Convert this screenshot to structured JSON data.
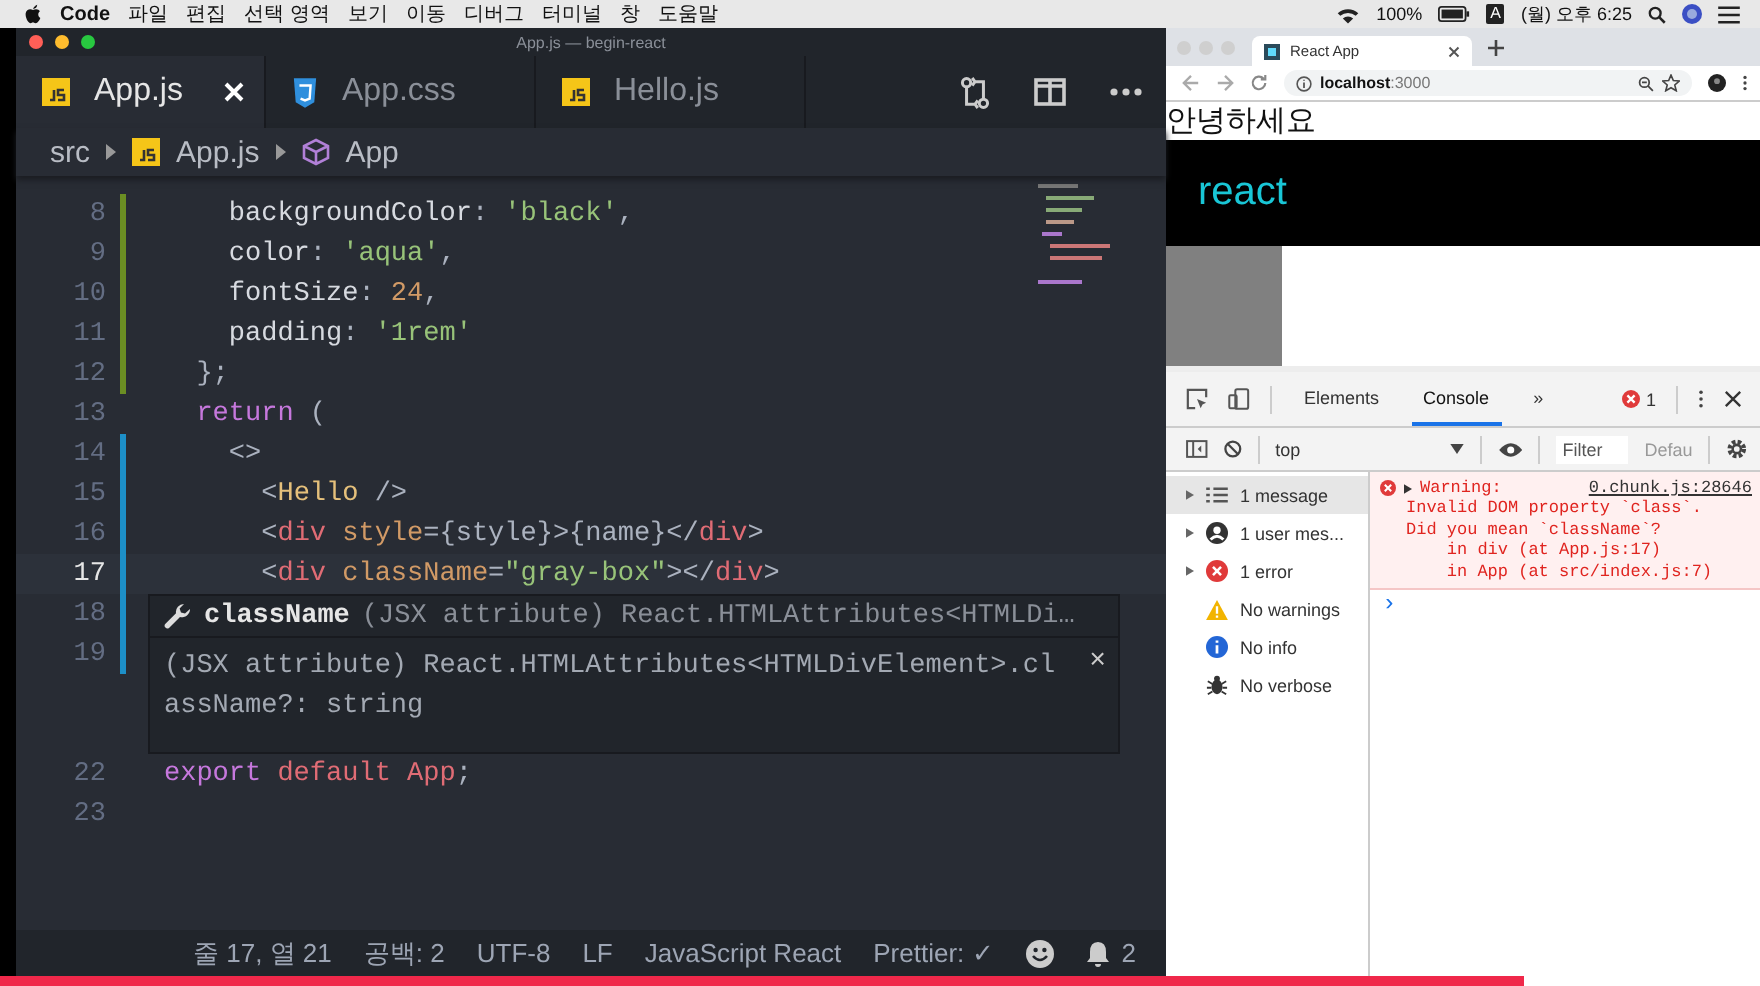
{
  "menubar": {
    "app": "Code",
    "menus": [
      "파일",
      "편집",
      "선택 영역",
      "보기",
      "이동",
      "디버그",
      "터미널",
      "창",
      "도움말"
    ],
    "battery": "100%",
    "input_source": "A",
    "clock": "(월) 오후 6:25"
  },
  "editor": {
    "window_title": "App.js — begin-react",
    "tabs": [
      {
        "label": "App.js",
        "kind": "js",
        "selected": true
      },
      {
        "label": "App.css",
        "kind": "css",
        "selected": false
      },
      {
        "label": "Hello.js",
        "kind": "js",
        "selected": false
      }
    ],
    "breadcrumb": [
      {
        "label": "src",
        "kind": "folder"
      },
      {
        "label": "App.js",
        "kind": "js"
      },
      {
        "label": "App",
        "kind": "symbol"
      }
    ],
    "lines": [
      {
        "number": "8",
        "color": "#6b8e23",
        "current": false,
        "tokens": [
          {
            "text": "    backgroundColor",
            "kind": "prop"
          },
          {
            "text": ": ",
            "kind": "punct"
          },
          {
            "text": "'black'",
            "kind": "string"
          },
          {
            "text": ",",
            "kind": "punct"
          }
        ]
      },
      {
        "number": "9",
        "color": "#6b8e23",
        "current": false,
        "tokens": [
          {
            "text": "    color",
            "kind": "prop"
          },
          {
            "text": ": ",
            "kind": "punct"
          },
          {
            "text": "'aqua'",
            "kind": "string"
          },
          {
            "text": ",",
            "kind": "punct"
          }
        ]
      },
      {
        "number": "10",
        "color": "#6b8e23",
        "current": false,
        "tokens": [
          {
            "text": "    fontSize",
            "kind": "prop"
          },
          {
            "text": ": ",
            "kind": "punct"
          },
          {
            "text": "24",
            "kind": "number"
          },
          {
            "text": ",",
            "kind": "punct"
          }
        ]
      },
      {
        "number": "11",
        "color": "#6b8e23",
        "current": false,
        "tokens": [
          {
            "text": "    padding",
            "kind": "prop"
          },
          {
            "text": ": ",
            "kind": "punct"
          },
          {
            "text": "'1rem'",
            "kind": "string"
          }
        ]
      },
      {
        "number": "12",
        "color": "#6b8e23",
        "current": false,
        "tokens": [
          {
            "text": "  };",
            "kind": "punct"
          }
        ]
      },
      {
        "number": "13",
        "current": false,
        "tokens": [
          {
            "text": "  return",
            "kind": "keyword"
          },
          {
            "text": " (",
            "kind": "punct"
          }
        ]
      },
      {
        "number": "14",
        "color": "#1d8fc7",
        "current": false,
        "tokens": [
          {
            "text": "    <>",
            "kind": "punct"
          }
        ]
      },
      {
        "number": "15",
        "color": "#1d8fc7",
        "current": false,
        "tokens": [
          {
            "text": "      <",
            "kind": "punct"
          },
          {
            "text": "Hello",
            "kind": "component"
          },
          {
            "text": " />",
            "kind": "punct"
          }
        ]
      },
      {
        "number": "16",
        "color": "#1d8fc7",
        "current": false,
        "tokens": [
          {
            "text": "      <",
            "kind": "punct"
          },
          {
            "text": "div",
            "kind": "tag"
          },
          {
            "text": " style",
            "kind": "attr"
          },
          {
            "text": "={style}>{name}</",
            "kind": "punct"
          },
          {
            "text": "div",
            "kind": "tag"
          },
          {
            "text": ">",
            "kind": "punct"
          }
        ]
      },
      {
        "number": "17",
        "color": "#1d8fc7",
        "current": true,
        "tokens": [
          {
            "text": "      <",
            "kind": "punct"
          },
          {
            "text": "div",
            "kind": "tag"
          },
          {
            "text": " className",
            "kind": "attr"
          },
          {
            "text": "=",
            "kind": "punct"
          },
          {
            "text": "\"gray-box\"",
            "kind": "string"
          },
          {
            "text": "></",
            "kind": "punct"
          },
          {
            "text": "div",
            "kind": "tag"
          },
          {
            "text": ">",
            "kind": "punct"
          }
        ]
      }
    ],
    "hover_lines": [
      {
        "number": "18",
        "color": "#1d8fc7",
        "current": false
      },
      {
        "number": "19",
        "color": "#1d8fc7",
        "current": false
      }
    ],
    "hover": {
      "name": "className",
      "signature": "(JSX attribute) React.HTMLAttributes<HTMLDi…",
      "doc": [
        "(JSX attribute) React.HTMLAttributes<HTMLDivElement>.cl",
        "assName?: string"
      ],
      "close": "×"
    },
    "lines_after": [
      {
        "number": "22",
        "current": false,
        "tokens": [
          {
            "text": "export",
            "kind": "keyword"
          },
          {
            "text": " default",
            "kind": "variable"
          },
          {
            "text": " App",
            "kind": "variable"
          },
          {
            "text": ";",
            "kind": "punct"
          }
        ]
      },
      {
        "number": "23",
        "current": false
      }
    ],
    "status_bar": {
      "items": [
        "줄 17, 열 21",
        "공백: 2",
        "UTF-8",
        "LF",
        "JavaScript React",
        "Prettier: ✓"
      ],
      "notifications": "2"
    }
  },
  "browser": {
    "tab_title": "React App",
    "url": "**localhost**:3000",
    "page": {
      "greeting": "안녕하세요",
      "styled_text": "react"
    },
    "devtools": {
      "tabs": [
        {
          "label": "Elements",
          "selected": false
        },
        {
          "label": "Console",
          "selected": true
        }
      ],
      "more_tabs": "»",
      "error_count": "1",
      "context": "top",
      "filter": {
        "placeholder": "Filter"
      },
      "levels": "Defau",
      "sidebar": [
        {
          "kind": "message",
          "label": "1 message",
          "expandable": true,
          "selected": true
        },
        {
          "kind": "user",
          "label": "1 user mes...",
          "expandable": true,
          "selected": false
        },
        {
          "kind": "error",
          "label": "1 error",
          "expandable": true,
          "selected": false
        },
        {
          "kind": "warning",
          "label": "No warnings",
          "expandable": false,
          "selected": false
        },
        {
          "kind": "info",
          "label": "No info",
          "expandable": false,
          "selected": false
        },
        {
          "kind": "verbose",
          "label": "No verbose",
          "expandable": false,
          "selected": false
        }
      ],
      "messages": [
        {
          "kind": "error",
          "title": "Warning:",
          "source": "0.chunk.js:28646",
          "lines": [
            "Invalid DOM property `class`.",
            "Did you mean `className`?",
            "    in div (at App.js:17)",
            "    in App (at src/index.js:7)"
          ]
        }
      ],
      "prompt": "›"
    }
  },
  "video_progress": {
    "level": 0.866
  }
}
